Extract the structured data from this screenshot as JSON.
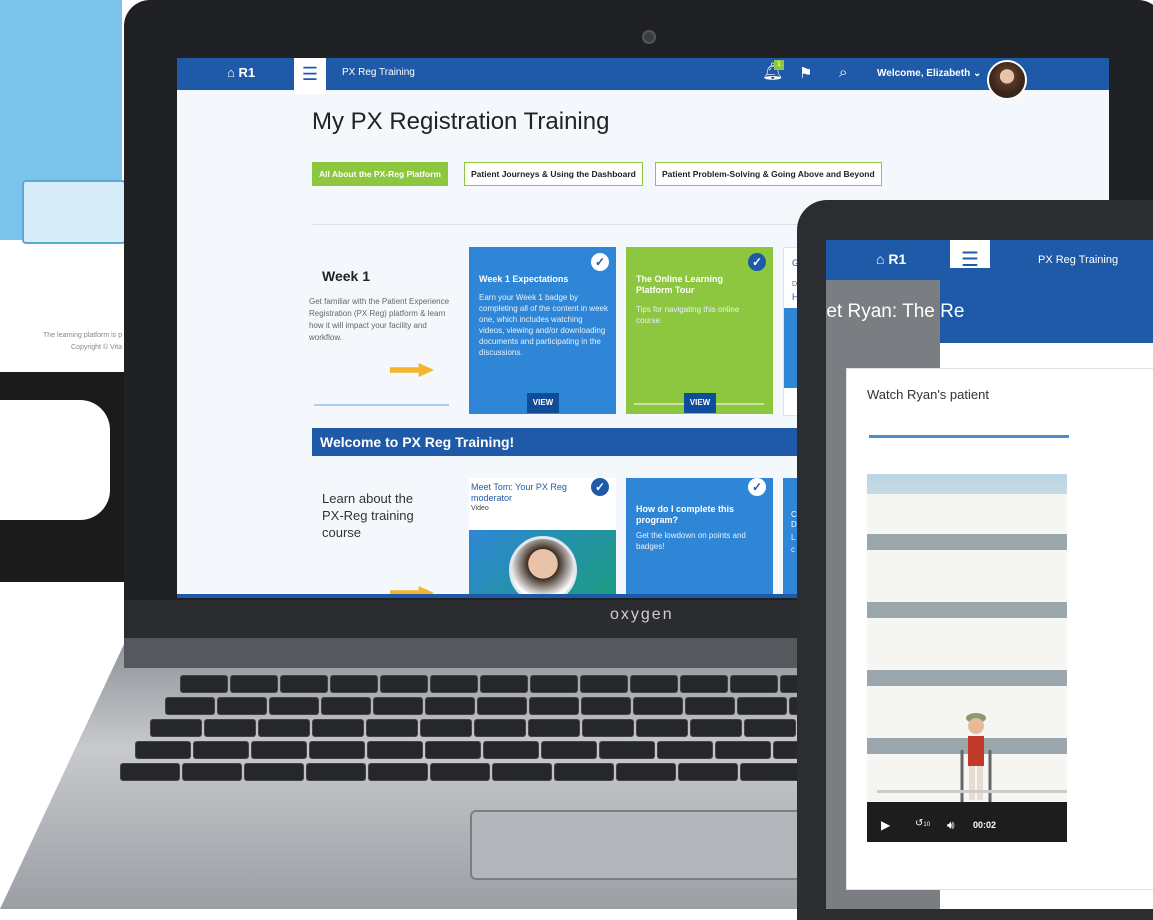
{
  "background_page": {
    "footer_line1": "The learning platform is p",
    "footer_line2": "Copyright © Vita"
  },
  "laptop": {
    "brand": "oxygen",
    "app": {
      "home_label": "R1",
      "breadcrumb": "PX Reg Training",
      "notification_count": "1",
      "welcome": "Welcome, Elizabeth",
      "page_title": "My PX Registration Training",
      "tabs": [
        {
          "label": "All About the PX-Reg Platform",
          "active": true
        },
        {
          "label": "Patient Journeys & Using the Dashboard",
          "active": false
        },
        {
          "label": "Patient Problem-Solving & Going Above and Beyond",
          "active": false
        }
      ],
      "week": {
        "title": "Week 1",
        "description": "Get familiar with the Patient Experience Registration (PX Reg) platform & learn how it will impact your facility and workflow."
      },
      "cards_row1": [
        {
          "title": "Week 1 Expectations",
          "description": "Earn your Week 1 badge by completing all of the content in week one, which includes watching videos, viewing and/or downloading documents and participating in the discussions.",
          "button": "VIEW",
          "color": "#2f86d6"
        },
        {
          "title": "The Online Learning Platform Tour",
          "description": "Tips for navigating this online course.",
          "button": "VIEW",
          "color": "#8dc63f"
        },
        {
          "title_partial": "G",
          "line2": "D",
          "line3": "H"
        }
      ],
      "banner": "Welcome to PX Reg Training!",
      "learn_text": "Learn about the PX-Reg training course",
      "cards_row2": [
        {
          "title": "Meet Tom: Your PX Reg moderator",
          "type": "Video"
        },
        {
          "title": "How do I complete this program?",
          "description": "Get the lowdown on points and badges!"
        },
        {
          "partial1": "C",
          "partial2": "D",
          "partial3": "L",
          "partial4": "c"
        }
      ]
    }
  },
  "tablet": {
    "home_label": "R1",
    "breadcrumb": "PX Reg Training",
    "modal_title": "Meet Ryan: The Re",
    "watch_text": "Watch Ryan's patient",
    "video_time": "00:02",
    "replay_label": "10"
  },
  "colors": {
    "brand_blue": "#1f5aa8",
    "accent_green": "#8dc63f",
    "arrow_yellow": "#f5b52a"
  }
}
